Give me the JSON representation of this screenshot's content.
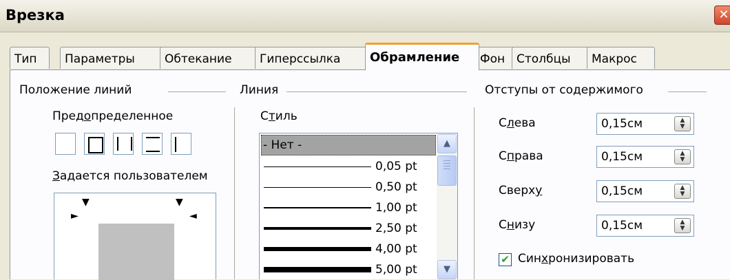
{
  "window": {
    "title": "Врезка",
    "close_glyph": "✕"
  },
  "tabs": [
    {
      "label": "Тип"
    },
    {
      "label": "Параметры"
    },
    {
      "label": "Обтекание"
    },
    {
      "label": "Гиперссылка"
    },
    {
      "label": "Обрамление",
      "active": true
    },
    {
      "label": "Фон"
    },
    {
      "label": "Столбцы"
    },
    {
      "label": "Макрос"
    }
  ],
  "line_arrangement": {
    "group_label": "Положение линий",
    "default_label_pre": "Пред",
    "default_label_ul": "о",
    "default_label_post": "пределенное",
    "user_label_ul": "З",
    "user_label_post": "адается пользователем",
    "presets": [
      "none",
      "box",
      "left-right",
      "top-bottom",
      "left"
    ]
  },
  "line": {
    "group_label": "Линия",
    "style_label_pre": "С",
    "style_label_ul": "т",
    "style_label_post": "иль",
    "styles": [
      {
        "label": "- Нет -",
        "selected": true
      },
      {
        "label": "0,05 pt"
      },
      {
        "label": "0,50 pt"
      },
      {
        "label": "1,00 pt"
      },
      {
        "label": "2,50 pt"
      },
      {
        "label": "4,00 pt"
      },
      {
        "label": "5,00 pt"
      }
    ]
  },
  "spacing": {
    "group_label": "Отступы от содержимого",
    "fields": [
      {
        "label_pre": "С",
        "label_ul": "л",
        "label_post": "ева",
        "value": "0,15см"
      },
      {
        "label_pre": "С",
        "label_ul": "п",
        "label_post": "рава",
        "value": "0,15см"
      },
      {
        "label_pre": "Сверх",
        "label_ul": "у",
        "label_post": "",
        "value": "0,15см"
      },
      {
        "label_pre": "С",
        "label_ul": "н",
        "label_post": "изу",
        "value": "0,15см"
      }
    ],
    "sync_label_pre": "Син",
    "sync_label_ul": "х",
    "sync_label_post": "ронизировать",
    "sync_checked": true
  }
}
